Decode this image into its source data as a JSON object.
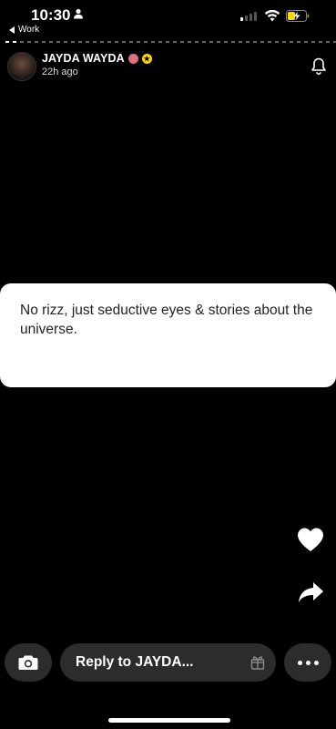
{
  "status_bar": {
    "time": "10:30",
    "back_label": "Work"
  },
  "story": {
    "user_name": "JAYDA WAYDA",
    "posted_ago": "22h ago",
    "text": "No rizz, just seductive eyes & stories about the universe."
  },
  "reply": {
    "placeholder": "Reply to JAYDA..."
  },
  "icons": {
    "person": "person-icon",
    "back": "back-arrow-icon",
    "signal": "cellular-signal-icon",
    "wifi": "wifi-icon",
    "battery": "battery-charging-icon",
    "bell": "bell-icon",
    "heart": "heart-icon",
    "share": "share-icon",
    "camera": "camera-icon",
    "gift": "gift-icon",
    "more": "more-icon"
  },
  "colors": {
    "background": "#000000",
    "card": "#ffffff",
    "pill": "#2c2c2c",
    "snapstar": "#ffd500"
  }
}
